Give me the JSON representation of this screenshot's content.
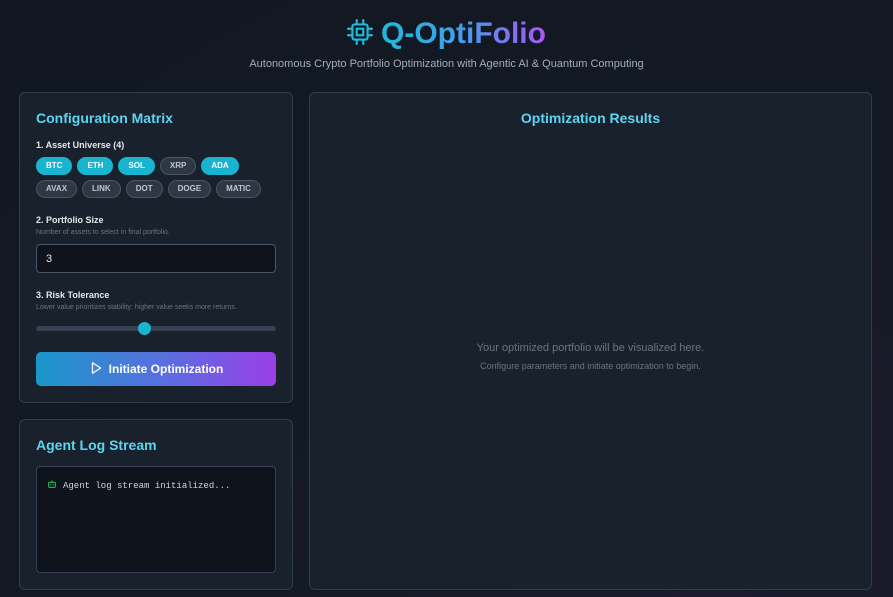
{
  "header": {
    "title": "Q-OptiFolio",
    "subtitle": "Autonomous Crypto Portfolio Optimization with Agentic AI & Quantum Computing",
    "icon": "cpu-chip-icon"
  },
  "config": {
    "title": "Configuration Matrix",
    "asset_label": "1. Asset Universe (4)",
    "assets": [
      {
        "label": "BTC",
        "selected": true
      },
      {
        "label": "ETH",
        "selected": true
      },
      {
        "label": "SOL",
        "selected": true
      },
      {
        "label": "XRP",
        "selected": false
      },
      {
        "label": "ADA",
        "selected": true
      },
      {
        "label": "AVAX",
        "selected": false
      },
      {
        "label": "LINK",
        "selected": false
      },
      {
        "label": "DOT",
        "selected": false
      },
      {
        "label": "DOGE",
        "selected": false
      },
      {
        "label": "MATIC",
        "selected": false
      }
    ],
    "size_label": "2. Portfolio Size",
    "size_help": "Number of assets to select in final portfolio.",
    "size_value": "3",
    "risk_label": "3. Risk Tolerance",
    "risk_help": "Lower value prioritizes stability; higher value seeks more returns.",
    "risk_value": 0.45,
    "button_label": "Initiate Optimization",
    "button_icon": "play-icon"
  },
  "log": {
    "title": "Agent Log Stream",
    "lines": [
      {
        "icon": "robot-icon",
        "text": "Agent log stream initialized..."
      }
    ]
  },
  "results": {
    "title": "Optimization Results",
    "empty_main": "Your optimized portfolio will be visualized here.",
    "empty_sub": "Configure parameters and initiate optimization to begin."
  },
  "colors": {
    "accent": "#18b4d0",
    "heading": "#5ed5f0",
    "gradient_end": "#a855f7",
    "card_bg": "#19212c",
    "page_bg": "#141a24"
  }
}
